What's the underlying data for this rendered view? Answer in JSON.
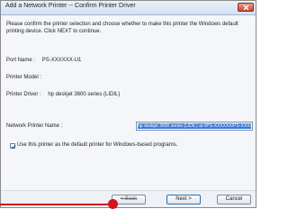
{
  "window": {
    "title": "Add a Network Printer -- Confirm Printer Driver",
    "close_icon": "close-icon"
  },
  "intro": "Please confirm the printer selection and choose whether to make this printer the Windows default printing device. Click NEXT to continue.",
  "fields": {
    "port_label": "Port Name :",
    "port_value": "PS-XXXXXX-U1",
    "model_label": "Printer Model :",
    "model_value": "",
    "driver_label": "Printer Driver :",
    "driver_value": "hp deskjet 3600 series (LIDIL)",
    "name_label": "Network Printer Name :",
    "name_value": "hp deskjet 3600 series (LIDIL) at //PS-XXXXXX/PS-XXXXXX-U1"
  },
  "default_checkbox": {
    "label": "Use this printer as the default printer for Windows-based programs.",
    "checked": true
  },
  "buttons": {
    "back": "< Back",
    "next": "Next >",
    "cancel": "Cancel"
  },
  "colors": {
    "annotation": "#d1141e",
    "selection": "#3a78d8"
  }
}
